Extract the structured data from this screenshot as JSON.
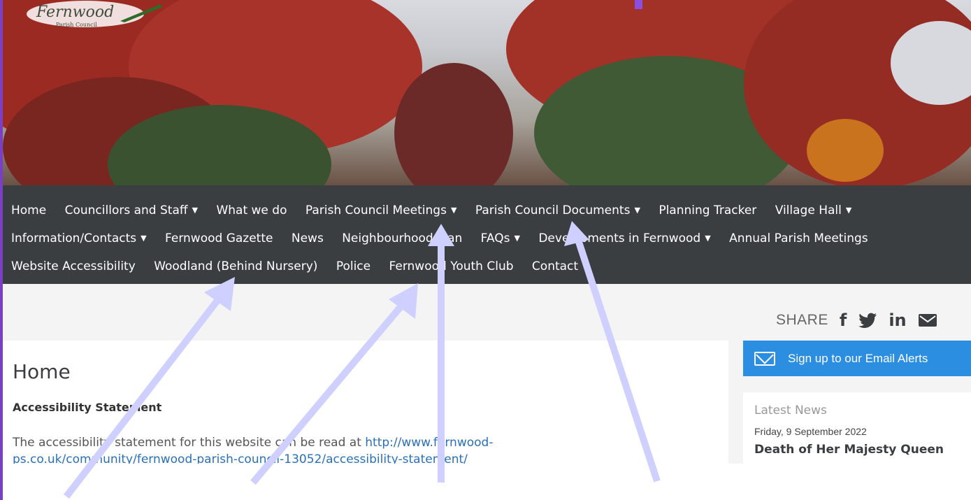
{
  "logo": {
    "name": "Fernwood",
    "subtitle": "Parish Council"
  },
  "nav": {
    "items": [
      {
        "label": "Home",
        "dropdown": false
      },
      {
        "label": "Councillors and Staff",
        "dropdown": true
      },
      {
        "label": "What we do",
        "dropdown": false
      },
      {
        "label": "Parish Council Meetings",
        "dropdown": true
      },
      {
        "label": "Parish Council Documents",
        "dropdown": true
      },
      {
        "label": "Planning Tracker",
        "dropdown": false
      },
      {
        "label": "Village Hall",
        "dropdown": true
      },
      {
        "label": "Information/Contacts",
        "dropdown": true
      },
      {
        "label": "Fernwood Gazette",
        "dropdown": false
      },
      {
        "label": "News",
        "dropdown": false
      },
      {
        "label": "Neighbourhood Plan",
        "dropdown": false
      },
      {
        "label": "FAQs",
        "dropdown": true
      },
      {
        "label": "Developments in Fernwood",
        "dropdown": true
      },
      {
        "label": "Annual Parish Meetings",
        "dropdown": false
      },
      {
        "label": "Website Accessibility",
        "dropdown": false
      },
      {
        "label": "Woodland (Behind Nursery)",
        "dropdown": false
      },
      {
        "label": "Police",
        "dropdown": false
      },
      {
        "label": "Fernwood Youth Club",
        "dropdown": false
      },
      {
        "label": "Contact",
        "dropdown": false
      }
    ]
  },
  "share": {
    "label": "SHARE",
    "icons": [
      "facebook-icon",
      "twitter-icon",
      "linkedin-icon",
      "mail-icon"
    ]
  },
  "email_alert": {
    "label": "Sign up to our Email Alerts"
  },
  "main": {
    "title": "Home",
    "subheading": "Accessibility Statement",
    "paragraph_prefix": "The accessibility statement for this website can be read at ",
    "paragraph_link": "http://www.fernwood-ps.co.uk/community/fernwood-parish-council-13052/accessibility-statement/"
  },
  "news": {
    "heading": "Latest News",
    "date": "Friday, 9 September 2022",
    "title": "Death of Her Majesty Queen"
  },
  "colors": {
    "nav_bg": "#3a3e41",
    "email_button": "#2c8ee0",
    "link": "#2a70b8",
    "arrow": "#cfd0ff",
    "frame": "#7b3fc4"
  }
}
